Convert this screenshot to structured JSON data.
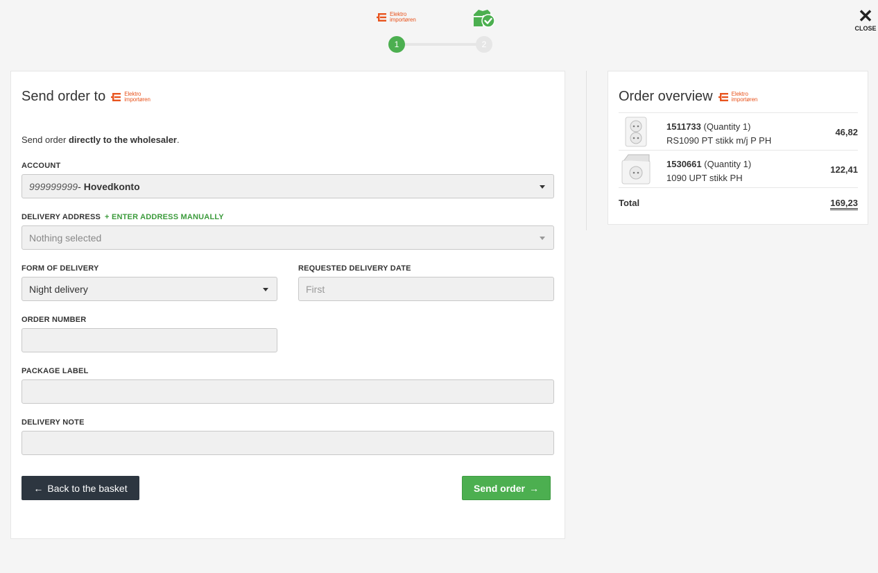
{
  "brand": {
    "line1": "Elektro",
    "line2": "importøren",
    "color": "#e8541e"
  },
  "steps": [
    "1",
    "2"
  ],
  "close": {
    "label": "CLOSE"
  },
  "form": {
    "title": "Send order to",
    "intro_prefix": "Send order ",
    "intro_bold": "directly to the wholesaler",
    "intro_suffix": ".",
    "account_label": "ACCOUNT",
    "account_number": "999999999",
    "account_sep": " -",
    "account_name": "Hovedkonto",
    "address_label": "DELIVERY ADDRESS",
    "address_manual": "ENTER ADDRESS MANUALLY",
    "address_value": "Nothing selected",
    "delivery_form_label": "FORM OF DELIVERY",
    "delivery_form_value": "Night delivery",
    "delivery_date_label": "REQUESTED DELIVERY DATE",
    "delivery_date_placeholder": "First",
    "order_number_label": "ORDER NUMBER",
    "order_number_value": "",
    "package_label_label": "PACKAGE LABEL",
    "package_label_value": "",
    "delivery_note_label": "DELIVERY NOTE",
    "delivery_note_value": "",
    "back_button": "Back to the basket",
    "send_button": "Send order"
  },
  "overview": {
    "title": "Order overview",
    "items": [
      {
        "sku": "1511733",
        "qty": "(Quantity 1)",
        "desc": "RS1090 PT stikk m/j P PH",
        "price": "46,82"
      },
      {
        "sku": "1530661",
        "qty": "(Quantity 1)",
        "desc": "1090 UPT stikk PH",
        "price": "122,41"
      }
    ],
    "total_label": "Total",
    "total_value": "169,23"
  },
  "colors": {
    "accent_green": "#4caf50",
    "dark_button": "#2d3640"
  }
}
